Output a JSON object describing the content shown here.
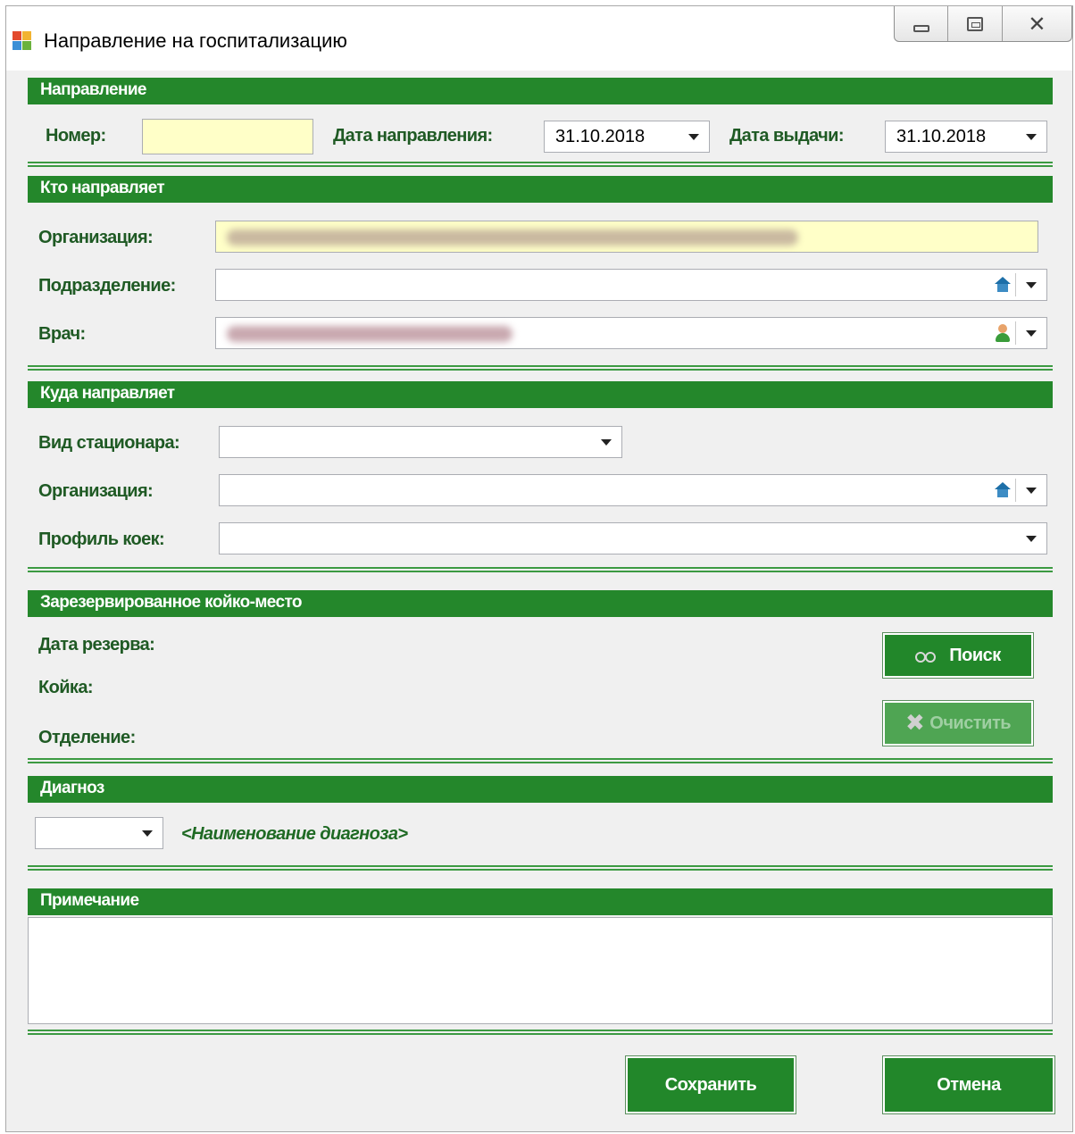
{
  "window": {
    "title": "Направление на госпитализацию",
    "controls": {
      "minimize": "minimize-icon",
      "maximize": "maximize-icon",
      "close": "✕"
    }
  },
  "direction": {
    "header": "Направление",
    "number_label": "Номер:",
    "number_value": "",
    "date_label": "Дата направления:",
    "date_value": "31.10.2018",
    "issue_label": "Дата выдачи:",
    "issue_value": "31.10.2018"
  },
  "who_directs": {
    "header": "Кто направляет",
    "org_label": "Организация:",
    "subdiv_label": "Подразделение:",
    "subdiv_value": "",
    "doctor_label": "Врач:"
  },
  "where_directs": {
    "header": "Куда направляет",
    "ward_type_label": "Вид стационара:",
    "ward_type_value": "",
    "org_label": "Организация:",
    "org_value": "",
    "bed_profile_label": "Профиль коек:",
    "bed_profile_value": ""
  },
  "reserved": {
    "header": "Зарезервированное койко-место",
    "date_label": "Дата резерва:",
    "bed_label": "Койка:",
    "dept_label": "Отделение:",
    "search_button": "Поиск",
    "clear_button": "Очистить"
  },
  "diagnosis": {
    "header": "Диагноз",
    "code_value": "",
    "name_placeholder": "<Наименование диагноза>"
  },
  "notes": {
    "header": "Примечание",
    "value": ""
  },
  "footer": {
    "save_button": "Сохранить",
    "cancel_button": "Отмена"
  },
  "colors": {
    "accent": "#24872b",
    "label_text": "#1f5a24",
    "highlight_field": "#ffffc8"
  }
}
